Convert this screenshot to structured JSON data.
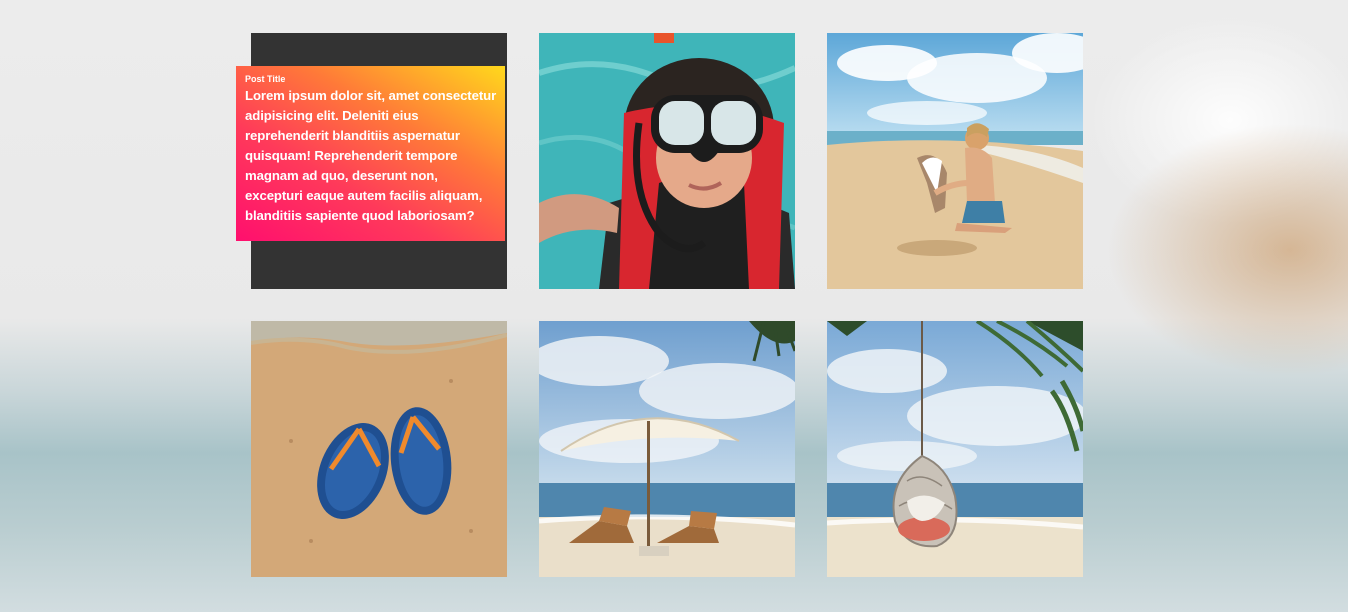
{
  "gallery": {
    "featured": {
      "title": "Post Title",
      "text": "Lorem ipsum dolor sit, amet consectetur adipisicing elit. Deleniti eius reprehenderit blanditiis aspernatur quisquam! Reprehenderit tempore magnam ad quo, deserunt non, excepturi eaque autem facilis aliquam, blanditiis sapiente quod laboriosam?"
    },
    "photos": [
      {
        "subject": "snorkel-girl"
      },
      {
        "subject": "boy-with-dog-on-beach"
      },
      {
        "subject": "flip-flops-on-sand"
      },
      {
        "subject": "beach-umbrella-and-loungers"
      },
      {
        "subject": "hanging-swing-chair"
      }
    ]
  },
  "colors": {
    "card_dark": "#333333",
    "gradient_start": "#ff0f6e",
    "gradient_end": "#ffd91c"
  }
}
